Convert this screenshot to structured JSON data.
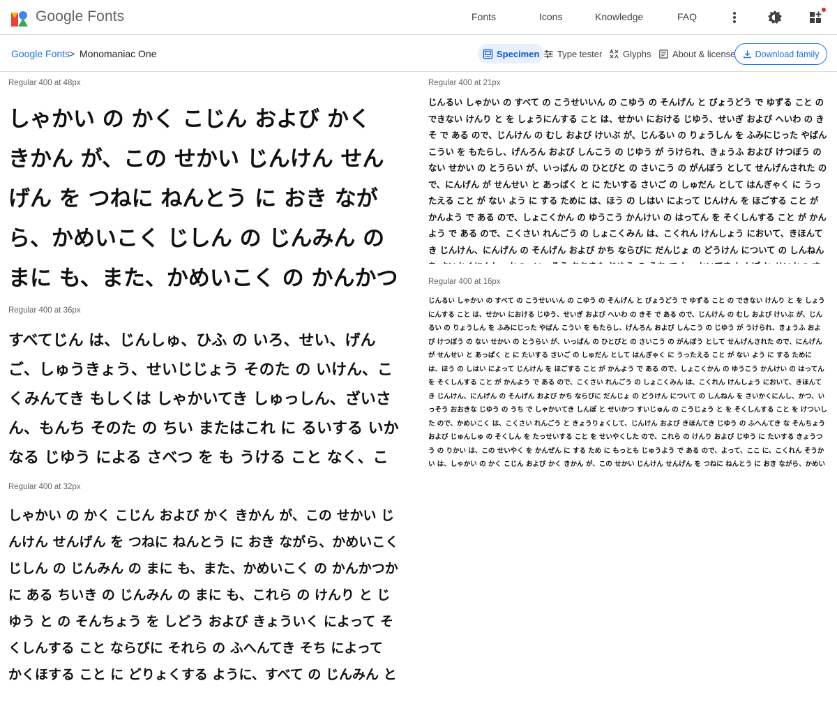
{
  "header": {
    "brand": "Google Fonts",
    "nav": [
      "Fonts",
      "Icons",
      "Knowledge",
      "FAQ"
    ],
    "icons": [
      "google-fonts-logo-icon",
      "more-vert-icon",
      "theme-toggle-icon",
      "apps-icon"
    ],
    "logo_colors": [
      "#ea4335",
      "#4285f4",
      "#fbbc04",
      "#34a853"
    ]
  },
  "breadcrumb": {
    "root": "Google Fonts",
    "separator": ">",
    "current": "Monomaniac One"
  },
  "tabs": [
    {
      "label": "Specimen",
      "icon": "specimen-icon",
      "active": true
    },
    {
      "label": "Type tester",
      "icon": "tune-icon",
      "active": false
    },
    {
      "label": "Glyphs",
      "icon": "glyphs-icon",
      "active": false
    },
    {
      "label": "About & license",
      "icon": "article-icon",
      "active": false
    }
  ],
  "download": {
    "label": "Download family",
    "icon": "download-icon"
  },
  "specimens": {
    "s48": {
      "label": "Regular 400 at 48px",
      "text": "しゃかい の かく こじん および かく きかん が、この せかい じんけん せんげん を つねに ねんとう に おき ながら、かめいこく じしん の じんみん の まに も、また、かめいこく の かんかつか に ある ちいき の じんみん の まに も"
    },
    "s36": {
      "label": "Regular 400 at 36px",
      "text": "すべてじん は、じんしゅ、ひふ の いろ、せい、げんご、しゅうきょう、せいじじょう そのた の いけん、こくみんてき もしくは しゃかいてき しゅっしん、ざいさん、もんち そのた の ちい またはこれ に るいする いかなる じゆう による さべつ を も うける こと なく、この せんげん に かかげる すべて の けんり と じゆう と を きょうゆうする こと が できる。"
    },
    "s32": {
      "label": "Regular 400 at 32px",
      "text": "しゃかい の かく こじん および かく きかん が、この せかい じんけん せんげん を つねに ねんとう に おき ながら、かめいこく じしん の じんみん の まに も、また、かめいこく の かんかつか に ある ちいき の じんみん の まに も、これら の けんり と じゆう と の そんちょう を しどう および きょういく によって そくしんする こと ならびに それら の ふへんてき そち によって かくほする こと に どりょくする ように、すべて の じんみん と すべて の くに と が たっせいす べき きょうつう の きじゅん として、この じんけん せんげん を こうふする。"
    },
    "s21": {
      "label": "Regular 400 at 21px",
      "text": "じんるい しゃかい の すべて の こうせいいん の こゆう の そんげん と びょうどう で ゆずる こと の できない けんり と を しょうにんする こと は、せかい における じゆう、せいぎ および へいわ の きそ で ある ので、じんけん の むし および けいぶ が、じんるい の りょうしん を ふみにじった やばん こうい を もたらし、げんろん および しんこう の じゆう が うけられ、きょうふ および けつぼう の ない せかい の とうらい が、いっぱん の ひとびと の さいこう の がんぼう として せんげんされた ので、にんげん が せんせい と あっぱく と に たいする さいご の しゅだん として はんぎゃく に うったえる こと が ない よう に する ために は、ほう の しはい によって じんけん を ほごする こと が かんよう で ある ので、しょこくかん の ゆうこう かんけい の はってん を そくしんする こと が かんよう で ある ので、こくさい れんごう の しょこくみん は、こくれん けんしょう において、きほんてき じんけん、にんげん の そんげん および かち ならびに だんじょ の どうけん について の しんねん を さいかくにんし、かつ、いっそう おおきな じゆう の うち で しゃかいてき しんぽ と せいかつ すいじゅん の こうじょう と を そくしんする こと を けついした ので、"
    },
    "s16": {
      "label": "Regular 400 at 16px",
      "text": "じんるい しゃかい の すべて の こうせいいん の こゆう の そんげん と びょうどう で ゆずる こと の できない けんり と を しょうにんする こと は、せかい における じゆう、せいぎ および へいわ の きそ で ある ので、じんけん の むし および けいぶ が、じんるい の りょうしん を ふみにじった やばん こうい を もたらし、げんろん および しんこう の じゆう が うけられ、きょうふ および けつぼう の ない せかい の とうらい が、いっぱん の ひとびと の さいこう の がんぼう として せんげんされた ので、にんげん が せんせい と あっぱく と に たいする さいご の しゅだん として はんぎゃく に うったえる こと が ない よう に する ために は、ほう の しはい によって じんけん を ほごする こと が かんよう で ある ので、しょこくかん の ゆうこう かんけい の はってん を そくしんする こと が かんよう で ある ので、こくさい れんごう の しょこくみん は、こくれん けんしょう において、きほんてき じんけん、にんげん の そんげん および かち ならびに だんじょ の どうけん について の しんねん を さいかくにんし、かつ、いっそう おおきな じゆう の うち で しゃかいてき しんぽ と せいかつ すいじゅん の こうじょう と を そくしんする こと を けついした ので、かめいこく は、こくさい れんごう と きょうりょくして、じんけん および きほんてき じゆう の ふへんてき な そんちょう および じゅんしゅ の そくしん を たっせいする こと を せいやくした ので、これら の けんり および じゆう に たいする きょうつう の りかい は、この せいやく を かんぜん に する ため に もっとも じゅうよう で ある ので、よって、ここ に、こくれん そうかい は、しゃかい の かく こじん および かく きかん が、この せかい じんけん せんげん を つねに ねんとう に おき ながら、かめいこく じしん の じんみん の まに も、また、かめいこく の かんかつか に ある ちいき の じんみん の まに も、これら の けんり と じゆう と の そんちょう を しどう および きょういく によって そくしんする こと ならびに それら の ふへんてき そち によって かくほする こと に どりょくする ように、すべて の じんみん と すべて の くに と が たっせいす べき きょうつう の きじゅん として、この じんけん せんげん を こうふする。"
    }
  }
}
